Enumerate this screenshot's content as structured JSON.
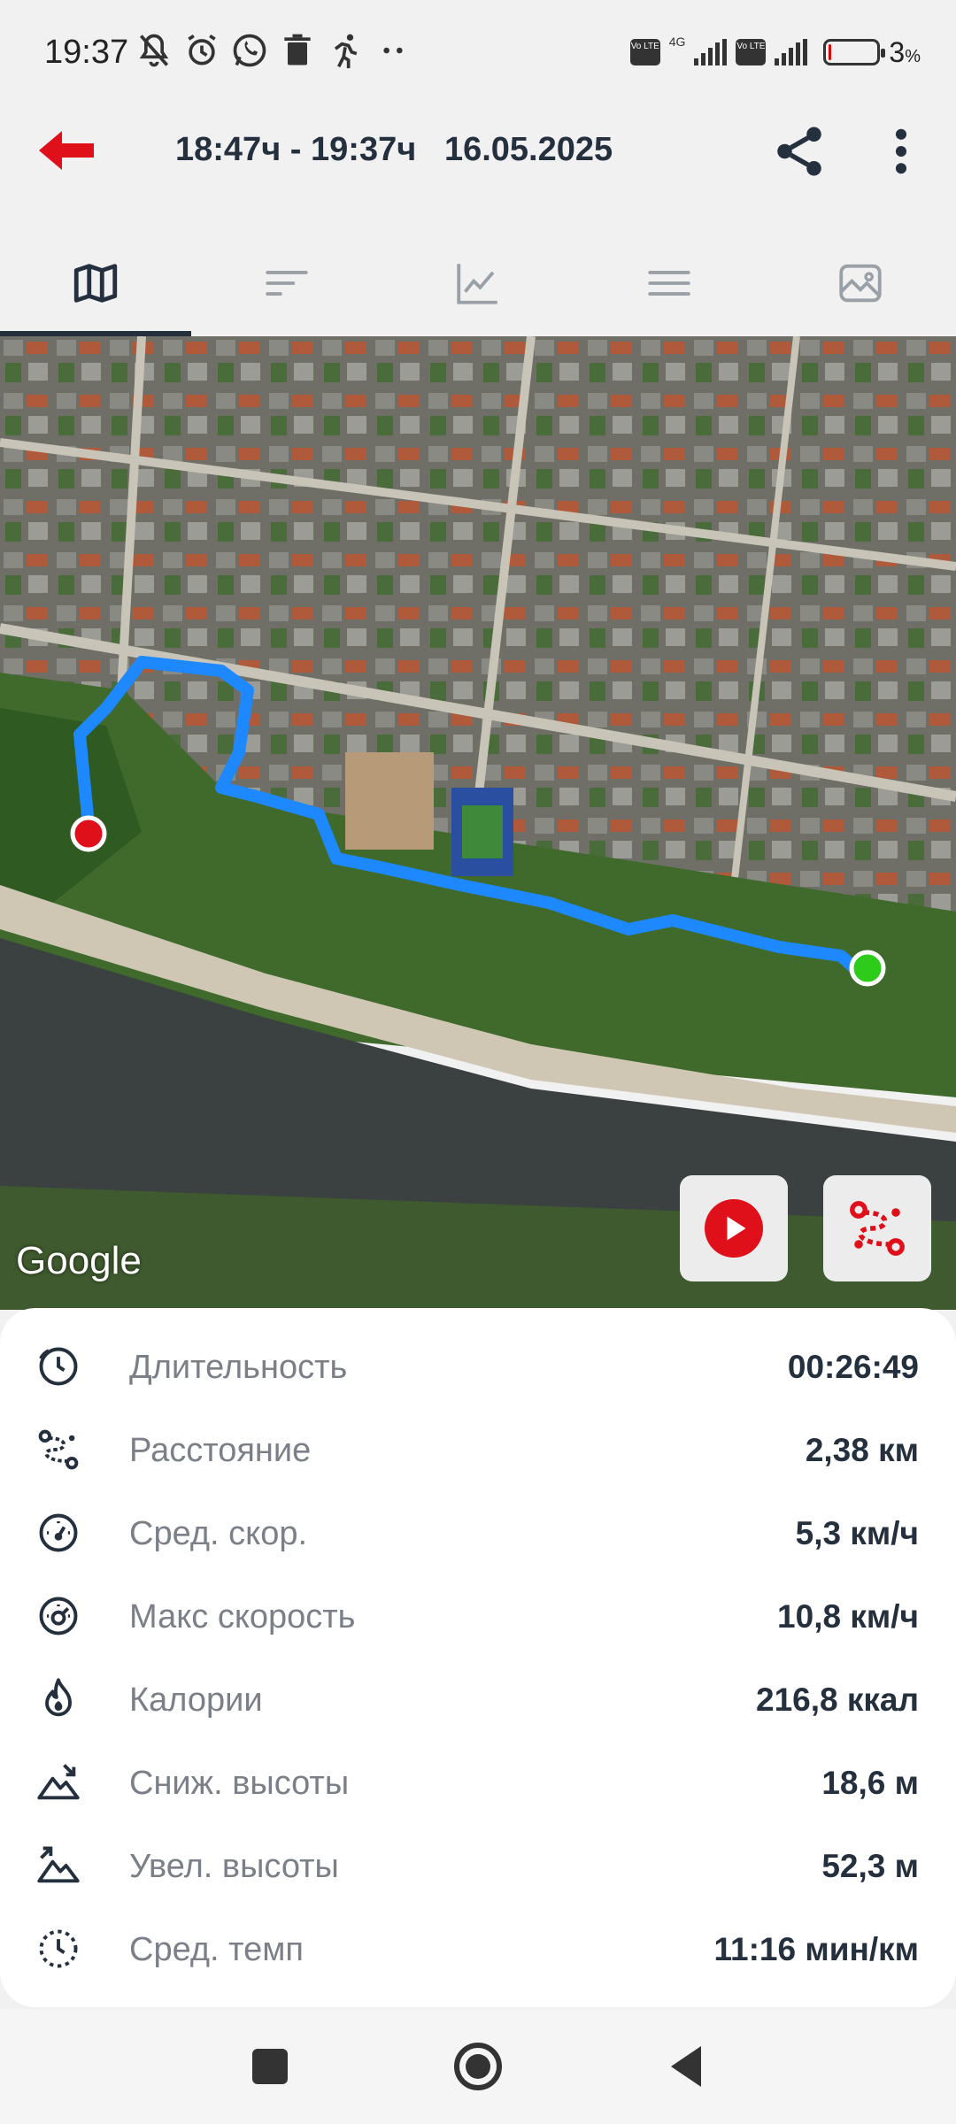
{
  "status_bar": {
    "time": "19:37",
    "icons": [
      "muted-bell-icon",
      "alarm-icon",
      "whatsapp-icon",
      "trash-icon",
      "running-icon",
      "more-dots-icon"
    ],
    "network_label": "4G",
    "volte_label": "Vo LTE",
    "battery_percent": "3",
    "battery_unit": "%"
  },
  "app_bar": {
    "title": "18:47ч - 19:37ч   16.05.2025",
    "back_icon": "back-arrow-icon",
    "share_icon": "share-icon",
    "more_icon": "more-vert-icon",
    "accent_color": "#e0101a"
  },
  "tabs": [
    {
      "name": "map",
      "icon": "map-icon",
      "active": true
    },
    {
      "name": "laps",
      "icon": "bars-icon",
      "active": false
    },
    {
      "name": "chart",
      "icon": "chart-icon",
      "active": false
    },
    {
      "name": "details",
      "icon": "menu-icon",
      "active": false
    },
    {
      "name": "photos",
      "icon": "image-icon",
      "active": false
    }
  ],
  "map": {
    "provider_logo": "Google",
    "track_color": "#1e88ff",
    "start_marker_color": "#2ecc1a",
    "end_marker_color": "#e0101a",
    "play_button_icon": "play-icon",
    "route_button_icon": "route-icon"
  },
  "stats": [
    {
      "label": "Длительность",
      "value": "00:26:49",
      "icon": "clock-icon"
    },
    {
      "label": "Расстояние",
      "value": "2,38 км",
      "icon": "route-icon"
    },
    {
      "label": "Сред. скор.",
      "value": "5,3 км/ч",
      "icon": "avg-speed-icon"
    },
    {
      "label": "Макс скорость",
      "value": "10,8 км/ч",
      "icon": "max-speed-icon"
    },
    {
      "label": "Калории",
      "value": "216,8 ккал",
      "icon": "flame-icon"
    },
    {
      "label": "Сниж. высоты",
      "value": "18,6 м",
      "icon": "descent-icon"
    },
    {
      "label": "Увел. высоты",
      "value": "52,3 м",
      "icon": "ascent-icon"
    },
    {
      "label": "Сред. темп",
      "value": "11:16 мин/км",
      "icon": "pace-icon"
    }
  ],
  "nav_bar": {
    "buttons": [
      "recents-square-icon",
      "home-circle-icon",
      "back-triangle-icon"
    ]
  }
}
